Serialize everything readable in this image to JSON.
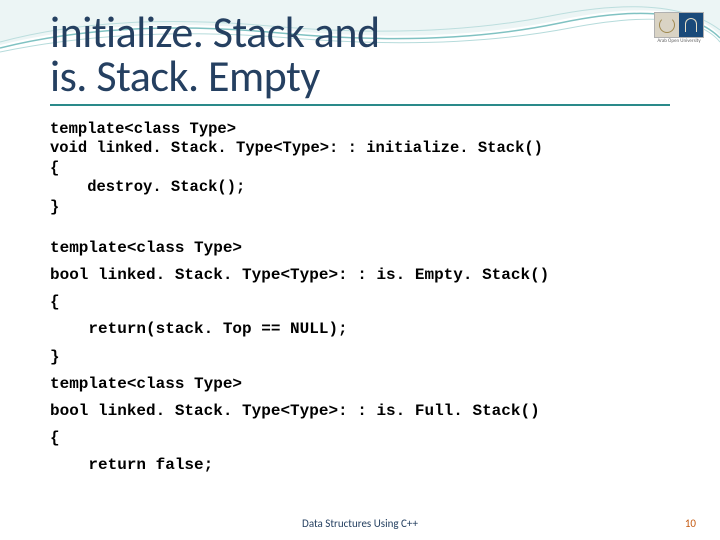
{
  "title_line1": "initialize. Stack and",
  "title_line2": "is. Stack. Empty",
  "code1": "template<class Type>\nvoid linked. Stack. Type<Type>: : initialize. Stack()\n{\n    destroy. Stack();\n}",
  "code2": "template<class Type>\nbool linked. Stack. Type<Type>: : is. Empty. Stack()\n{\n    return(stack. Top == NULL);\n}\ntemplate<class Type>\nbool linked. Stack. Type<Type>: : is. Full. Stack()\n{\n    return false;",
  "footer_text": "Data Structures Using C++",
  "page_number": "10",
  "logo_text": "Arab Open University"
}
